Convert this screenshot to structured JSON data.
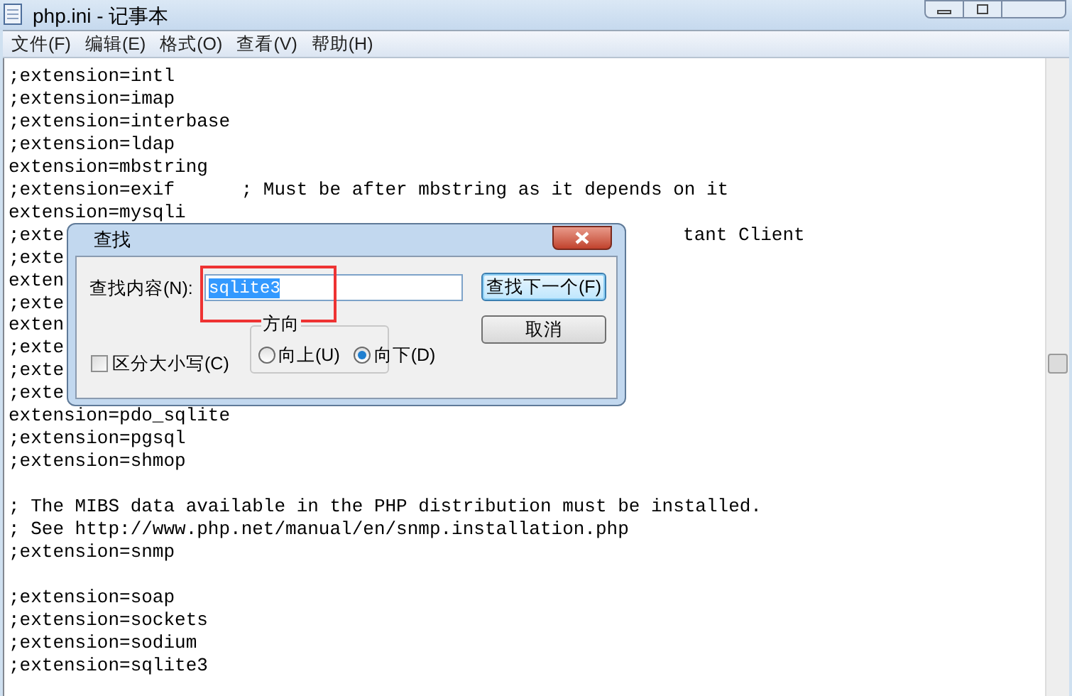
{
  "window": {
    "title": "php.ini - 记事本"
  },
  "menu": [
    "文件(F)",
    "编辑(E)",
    "格式(O)",
    "查看(V)",
    "帮助(H)"
  ],
  "blocks": [
    [
      {
        "text": ";extension=intl"
      },
      {
        "text": ";extension=imap"
      },
      {
        "text": ";extension=interbase"
      },
      {
        "text": ";extension=ldap"
      },
      {
        "text": "extension=mbstring"
      },
      {
        "text": ";extension=exif      ; Must be after mbstring as it depends on it"
      },
      {
        "text": "extension=mysqli"
      },
      {
        "text": ";exte",
        "tail": "tant Client"
      },
      {
        "text": ";exte"
      },
      {
        "text": "exten"
      },
      {
        "text": ";exte"
      },
      {
        "text": "exten"
      },
      {
        "text": ";exte"
      },
      {
        "text": ";exte"
      },
      {
        "text": ";exte"
      },
      {
        "text": "extension=pdo_sqlite"
      },
      {
        "text": ";extension=pgsql"
      },
      {
        "text": ";extension=shmop"
      }
    ],
    [
      {
        "text": "; The MIBS data available in the PHP distribution must be installed."
      },
      {
        "text": "; See http://www.php.net/manual/en/snmp.installation.php"
      },
      {
        "text": ";extension=snmp"
      }
    ],
    [
      {
        "text": ";extension=soap"
      },
      {
        "text": ";extension=sockets"
      },
      {
        "text": ";extension=sodium"
      },
      {
        "text": ";extension=sqlite3"
      }
    ]
  ],
  "find_dialog": {
    "title": "查找",
    "find_label": "查找内容(N):",
    "find_value": "sqlite3",
    "find_next_button": "查找下一个(F)",
    "cancel_button": "取消",
    "direction": {
      "label": "方向",
      "options": [
        {
          "label": "向上(U)",
          "selected": false
        },
        {
          "label": "向下(D)",
          "selected": true
        }
      ]
    },
    "match_case": {
      "label": "区分大小写(C)",
      "checked": false
    },
    "highlight": true
  }
}
